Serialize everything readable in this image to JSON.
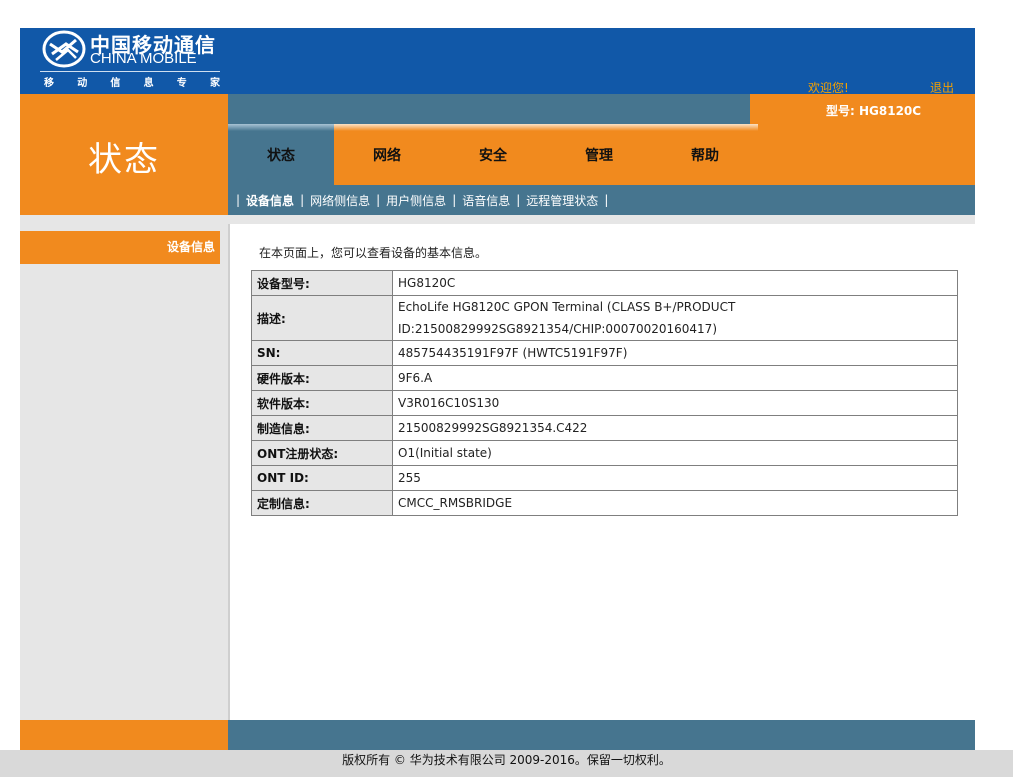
{
  "brand": {
    "name_cn": "中国移动通信",
    "name_en": "CHINA MOBILE",
    "slogan": [
      "移",
      "动",
      "信",
      "息",
      "专",
      "家"
    ],
    "logo_icon": "china-mobile-logo-icon",
    "colors": {
      "primary_blue": "#1158a8",
      "orange": "#f18a1e",
      "steel_blue": "#46758f",
      "link_orange": "#f5a000"
    }
  },
  "header": {
    "welcome": "欢迎您!",
    "logout": "退出",
    "page_title": "状态",
    "model": "型号: HG8120C"
  },
  "nav": {
    "tabs": [
      {
        "label": "状态"
      },
      {
        "label": "网络"
      },
      {
        "label": "安全"
      },
      {
        "label": "管理"
      },
      {
        "label": "帮助"
      }
    ],
    "active_tab": "状态",
    "sub_items": [
      {
        "label": "设备信息"
      },
      {
        "label": "网络侧信息"
      },
      {
        "label": "用户侧信息"
      },
      {
        "label": "语音信息"
      },
      {
        "label": "远程管理状态"
      }
    ],
    "active_sub_item": "设备信息",
    "separator": "|"
  },
  "sidebar": {
    "items": [
      {
        "label": "设备信息"
      }
    ]
  },
  "content": {
    "intro": "在本页面上，您可以查看设备的基本信息。",
    "rows": [
      {
        "label": "设备型号:",
        "value": "HG8120C"
      },
      {
        "label": "描述:",
        "value": "EchoLife HG8120C GPON Terminal (CLASS B+/PRODUCT ID:21500829992SG8921354/CHIP:00070020160417)"
      },
      {
        "label": "SN:",
        "value": "485754435191F97F (HWTC5191F97F)"
      },
      {
        "label": "硬件版本:",
        "value": "9F6.A"
      },
      {
        "label": "软件版本:",
        "value": "V3R016C10S130"
      },
      {
        "label": "制造信息:",
        "value": "21500829992SG8921354.C422"
      },
      {
        "label": "ONT注册状态:",
        "value": "O1(Initial state)"
      },
      {
        "label": "ONT ID:",
        "value": "255"
      },
      {
        "label": "定制信息:",
        "value": "CMCC_RMSBRIDGE"
      }
    ]
  },
  "footer": {
    "copyright": "版权所有 © 华为技术有限公司 2009-2016。保留一切权利。"
  }
}
